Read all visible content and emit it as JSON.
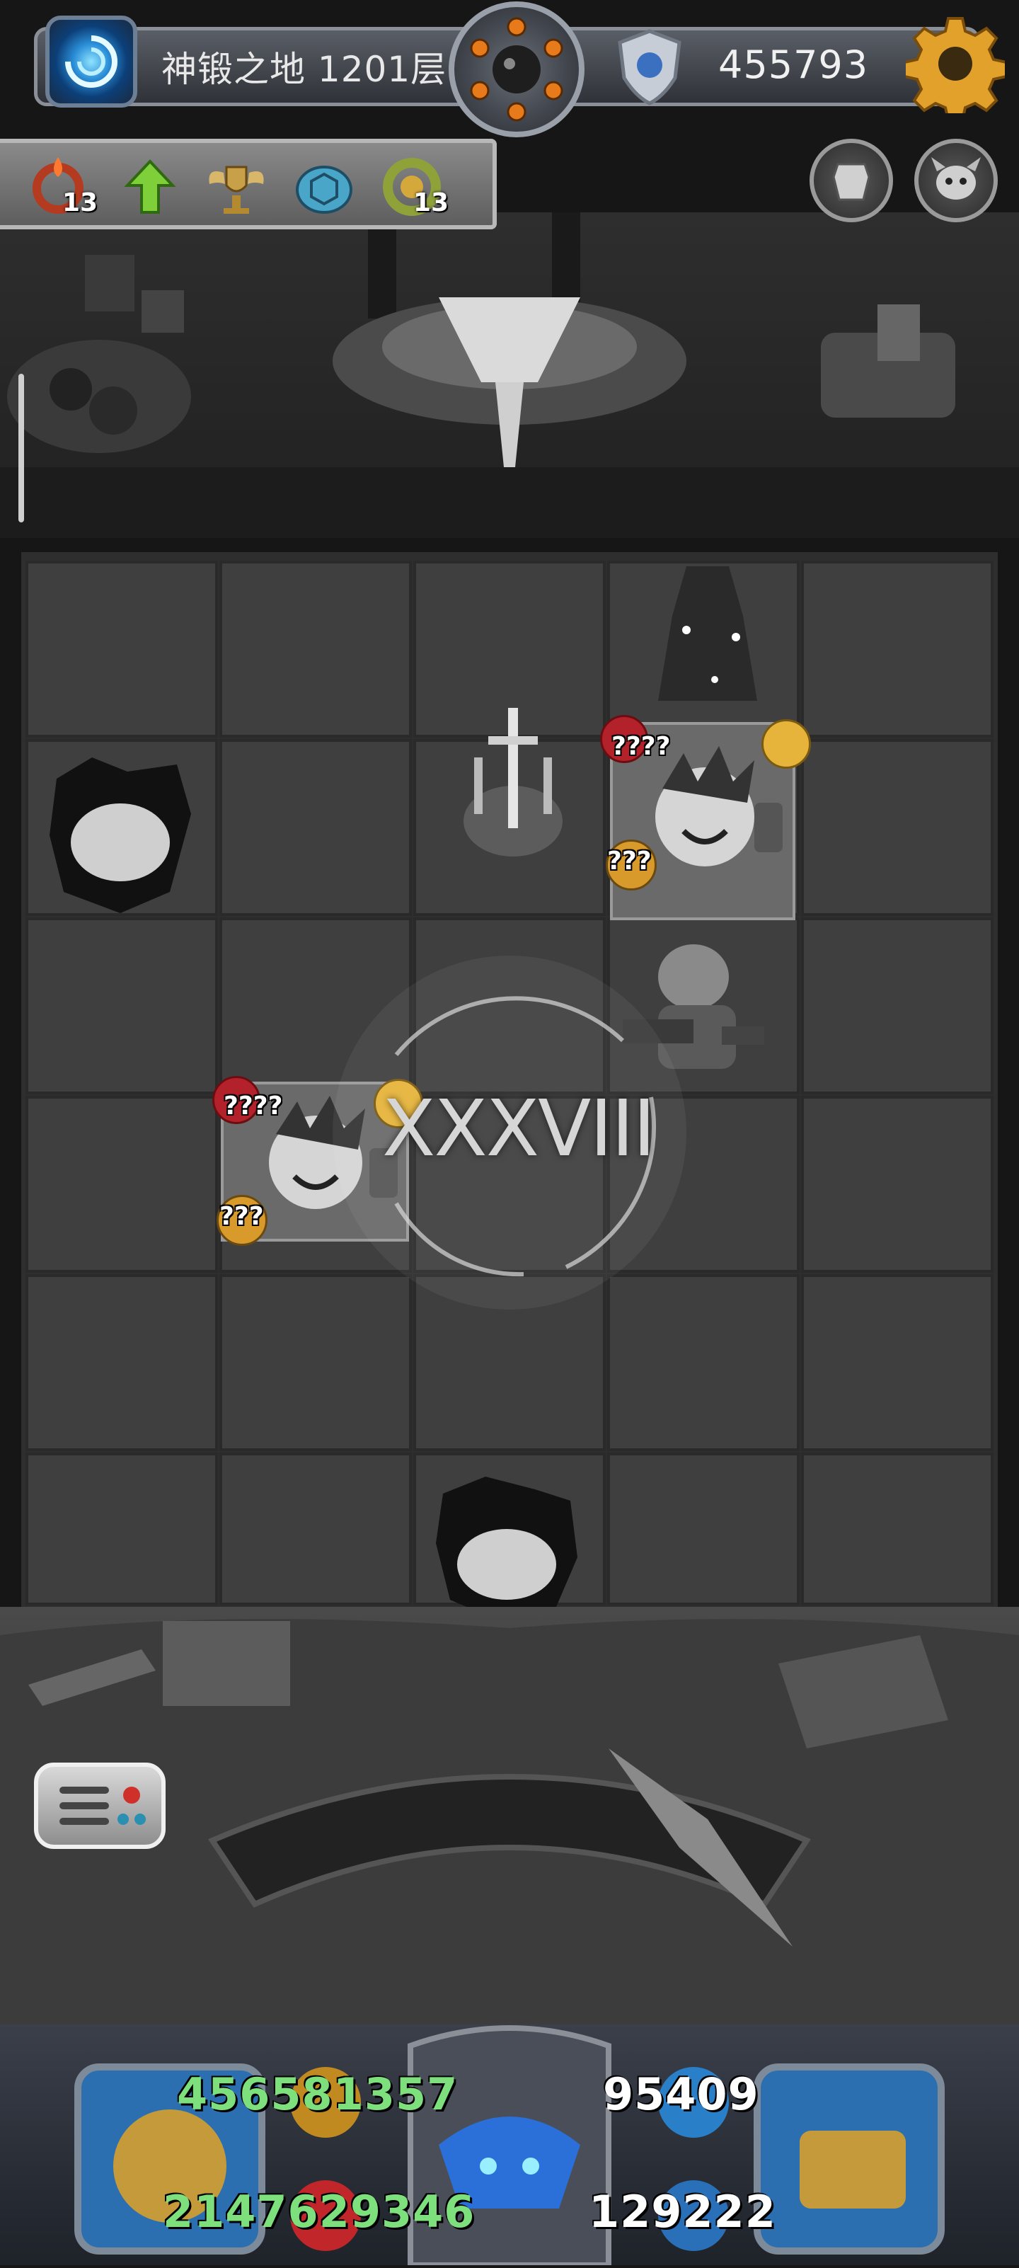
{
  "header": {
    "level": "神锻之地 1201层",
    "coins": "455793",
    "icons": [
      "portal-icon",
      "bomb-icon",
      "shield-icon",
      "gear-icon"
    ]
  },
  "buffs": [
    {
      "icon": "flame-ring-icon",
      "count": "13"
    },
    {
      "icon": "green-arrow-up-icon",
      "count": ""
    },
    {
      "icon": "winged-trophy-icon",
      "count": ""
    },
    {
      "icon": "turtle-shell-icon",
      "count": ""
    },
    {
      "icon": "golden-wreath-icon",
      "count": "13"
    }
  ],
  "side_buttons": [
    "armor-button",
    "demon-mask-button"
  ],
  "board": {
    "floor_label": "XXXVIII",
    "enemies": [
      {
        "hp": "????",
        "atk": "???"
      },
      {
        "hp": "????",
        "atk": "???"
      }
    ]
  },
  "stats": {
    "attack": "456581357",
    "defense": "95409",
    "hp": "2147629346",
    "mana": "129222"
  },
  "colors": {
    "attack": "#7de07d",
    "hp": "#7de07d",
    "defense": "#ffffff",
    "mana": "#ffffff"
  }
}
